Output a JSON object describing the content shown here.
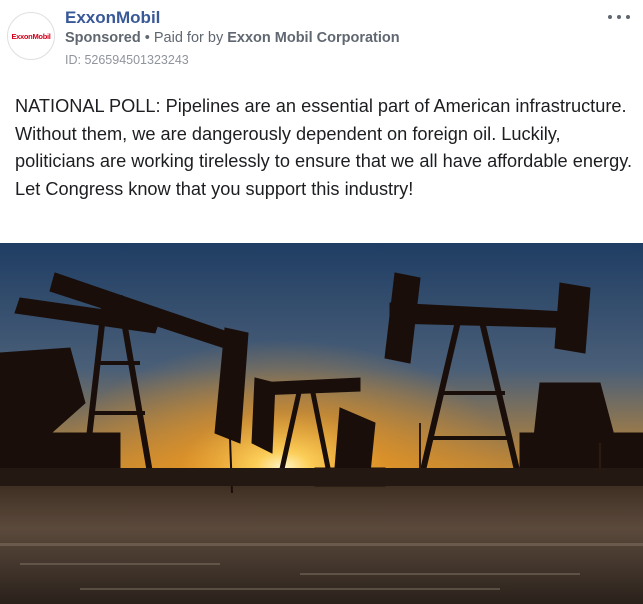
{
  "post": {
    "page_name": "ExxonMobil",
    "avatar_logo_text": "ExxonMobil",
    "sponsored_label": "Sponsored",
    "separator": " • ",
    "paid_for_prefix": "Paid for by ",
    "payer": "Exxon Mobil Corporation",
    "ad_id": "ID: 526594501323243",
    "more_icon": "more-horizontal-icon",
    "body_text": "NATIONAL POLL: Pipelines are an essential part of American infrastructure. Without them, we are dangerously dependent on foreign oil. Luckily, politicians are working tirelessly to ensure that we all have affordable energy. Let Congress know that you support this industry!",
    "image_subject": "pumpjacks at sunset"
  },
  "colors": {
    "page_name": "#385898",
    "meta_text": "#606770",
    "id_text": "#90949c",
    "body_text": "#1c1e21",
    "logo_red": "#d6001c"
  }
}
